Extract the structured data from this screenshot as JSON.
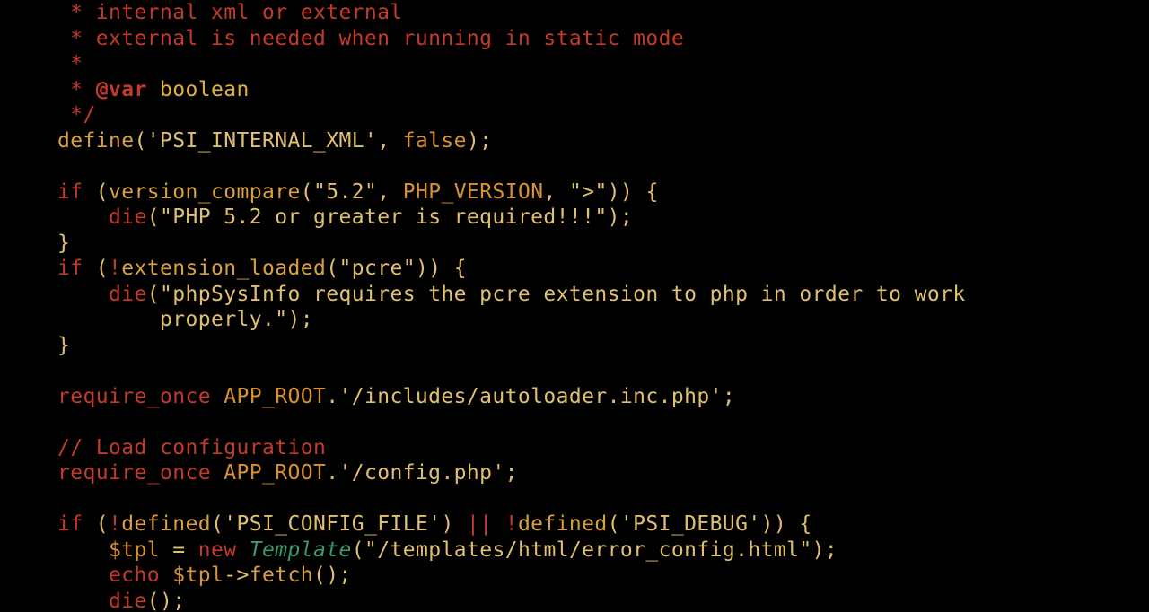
{
  "code": {
    "comment": {
      "l1": " * internal xml or external",
      "l2": " * external is needed when running in static mode",
      "l3": " *",
      "l4star": " * ",
      "l4ann": "@var",
      "l4type": " boolean",
      "l5": " */"
    },
    "define": {
      "fn": "define",
      "open": "(",
      "str": "'PSI_INTERNAL_XML'",
      "comma": ", ",
      "val": "false",
      "close": ");"
    },
    "if1": {
      "kw": "if",
      "open": " (",
      "fn": "version_compare",
      "popen": "(",
      "a1": "\"5.2\"",
      "c1": ", ",
      "a2": "PHP_VERSION",
      "c2": ", ",
      "a3": "\">\"",
      "pclose": ")) {",
      "indent": "    ",
      "die": "die",
      "dopen": "(",
      "dstr": "\"PHP 5.2 or greater is required!!!\"",
      "dclose": ");",
      "end": "}"
    },
    "if2": {
      "kw": "if",
      "open": " (",
      "not": "!",
      "fn": "extension_loaded",
      "popen": "(",
      "a1": "\"pcre\"",
      "pclose": ")) {",
      "indent": "    ",
      "die": "die",
      "dopen": "(",
      "dstr1": "\"phpSysInfo requires the pcre extension to php in order to work",
      "contIndent": "        ",
      "dstr2": "properly.\"",
      "dclose": ");",
      "end": "}"
    },
    "req1": {
      "kw": "require_once",
      "sp": " ",
      "con": "APP_ROOT",
      "dot": ".",
      "str": "'/includes/autoloader.inc.php'",
      "semi": ";"
    },
    "loadcmt": "// Load configuration",
    "req2": {
      "kw": "require_once",
      "sp": " ",
      "con": "APP_ROOT",
      "dot": ".",
      "str": "'/config.php'",
      "semi": ";"
    },
    "if3": {
      "kw": "if",
      "open": " (",
      "not1": "!",
      "fn1": "defined",
      "p1o": "(",
      "s1": "'PSI_CONFIG_FILE'",
      "p1c": ") ",
      "oror": "||",
      "sp": " ",
      "not2": "!",
      "fn2": "defined",
      "p2o": "(",
      "s2": "'PSI_DEBUG'",
      "p2c": ")) {",
      "indent": "    ",
      "var": "$tpl",
      "eq": " = ",
      "new": "new",
      "sp2": " ",
      "cls": "Template",
      "topen": "(",
      "tstr": "\"/templates/html/error_config.html\"",
      "tclose": ");",
      "echo": "echo",
      "esp": " ",
      "evar": "$tpl",
      "arrow": "->",
      "fetch": "fetch",
      "fcall": "();",
      "die": "die",
      "dcall": "();"
    }
  }
}
